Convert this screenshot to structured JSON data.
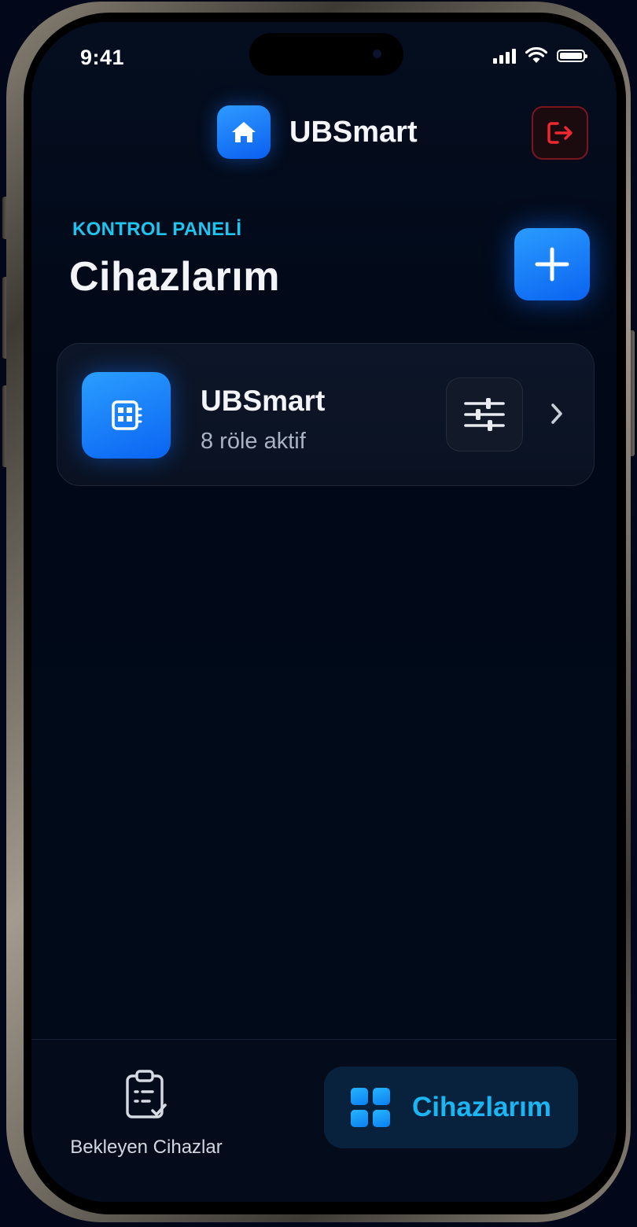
{
  "status_bar": {
    "time": "9:41",
    "icons": [
      "cellular-signal-icon",
      "wifi-icon",
      "battery-icon"
    ]
  },
  "header": {
    "logo_icon": "home-icon",
    "title": "UBSmart",
    "logout_icon": "logout-icon"
  },
  "section": {
    "kicker": "KONTROL PANELİ",
    "title": "Cihazlarım",
    "add_icon": "plus-icon"
  },
  "devices": [
    {
      "name": "UBSmart",
      "status": "8 röle aktif",
      "icon": "relay-board-icon",
      "settings_icon": "sliders-icon",
      "chevron_icon": "chevron-right-icon"
    }
  ],
  "tab_bar": {
    "pending": {
      "label": "Bekleyen Cihazlar",
      "icon": "clipboard-check-icon"
    },
    "devices": {
      "label": "Cihazlarım",
      "icon": "grid-icon",
      "active": true
    }
  },
  "colors": {
    "background": "#02081a",
    "accent_blue": "#0a63f0",
    "accent_cyan": "#1fc4f0",
    "danger_red": "#e0262e",
    "card": "#0d1628"
  }
}
